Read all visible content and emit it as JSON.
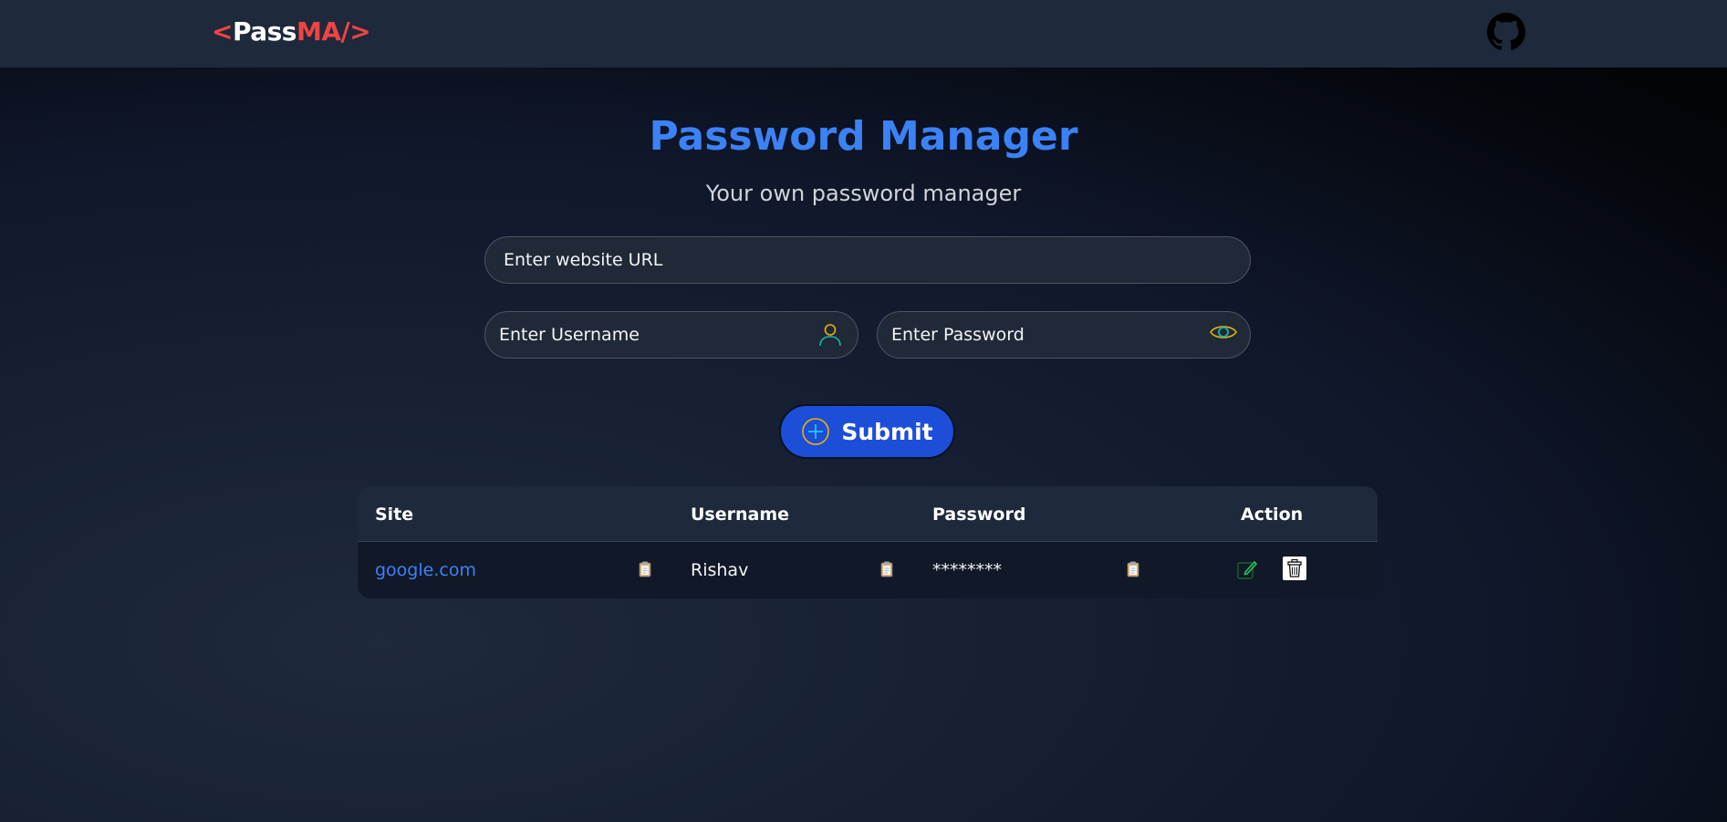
{
  "navbar": {
    "logo": {
      "open": "<",
      "pass": "Pass",
      "ma": "MA",
      "close": "/>"
    }
  },
  "hero": {
    "title": "Password Manager",
    "subtitle": "Your own password manager"
  },
  "form": {
    "url_placeholder": "Enter website URL",
    "username_placeholder": "Enter Username",
    "password_placeholder": "Enter Password",
    "submit_label": "Submit"
  },
  "table": {
    "headers": [
      "Site",
      "Username",
      "Password",
      "Action"
    ],
    "rows": [
      {
        "site": "google.com",
        "username": "Rishav",
        "password": "********"
      }
    ]
  },
  "icons": {
    "github": "github-icon",
    "user": "user-icon",
    "eye": "eye-icon",
    "plus": "plus-circle-icon",
    "copy": "clipboard-icon",
    "edit": "pencil-icon",
    "delete": "trash-icon"
  },
  "colors": {
    "accent_blue": "#3b82f6",
    "logo_red": "#ef4444",
    "button_blue": "#1d4ed8",
    "icon_teal": "#14b8a6",
    "icon_yellow": "#eab308"
  }
}
